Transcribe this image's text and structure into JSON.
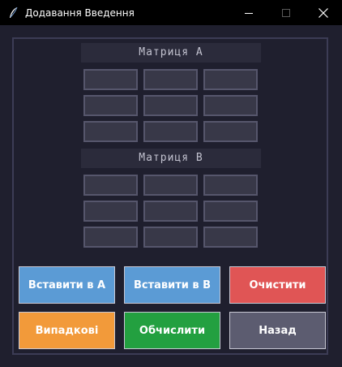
{
  "window": {
    "title": "Додавання Введення",
    "app_icon": "feather-icon",
    "controls": [
      "minimize-icon",
      "maximize-icon",
      "close-icon"
    ]
  },
  "matrix_a": {
    "label": "Матриця A",
    "rows": [
      [
        "",
        "",
        ""
      ],
      [
        "",
        "",
        ""
      ],
      [
        "",
        "",
        ""
      ]
    ]
  },
  "matrix_b": {
    "label": "Матриця B",
    "rows": [
      [
        "",
        "",
        ""
      ],
      [
        "",
        "",
        ""
      ],
      [
        "",
        "",
        ""
      ]
    ]
  },
  "buttons": {
    "insert_a": {
      "label": "Вставити в A",
      "color": "#5b9bd5"
    },
    "insert_b": {
      "label": "Вставити в B",
      "color": "#5b9bd5"
    },
    "clear": {
      "label": "Очистити",
      "color": "#e05555"
    },
    "random": {
      "label": "Випадкові",
      "color": "#f29a3a"
    },
    "calculate": {
      "label": "Обчислити",
      "color": "#23a040"
    },
    "back": {
      "label": "Назад",
      "color": "#5c5c70"
    }
  },
  "colors": {
    "background": "#1f1f2e",
    "cell": "#383848",
    "label_bg": "#2b2b3b"
  }
}
